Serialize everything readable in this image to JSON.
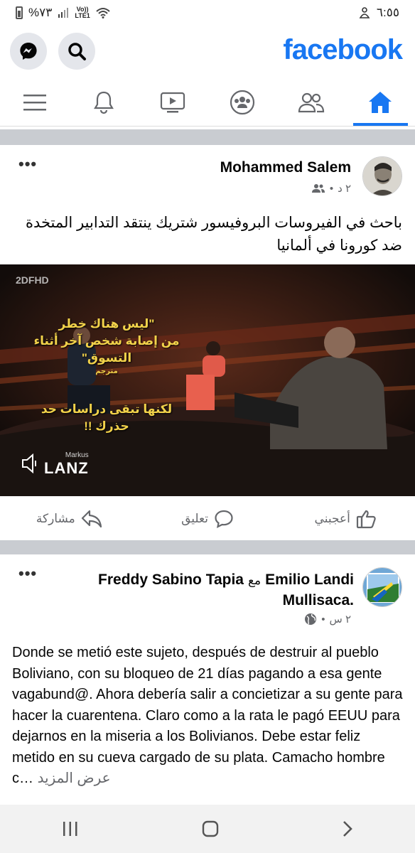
{
  "status_bar": {
    "battery": "%٧٣",
    "network": "Vo))",
    "network_sub": "LTE1",
    "time": "٦:٥٥"
  },
  "header": {
    "brand": "facebook"
  },
  "nav": {
    "items": [
      "menu-icon",
      "bell-icon",
      "video-icon",
      "groups-icon",
      "friends-icon",
      "home-icon"
    ],
    "active": "home-icon"
  },
  "post1": {
    "author": "Mohammed Salem",
    "time": "٢ د",
    "text": "باحث في الفيروسات البروفيسور شتريك ينتقد التدابير المتخدة ضد كورونا في ألمانيا",
    "video": {
      "channel": "2DFHD",
      "overlay_lines": [
        "\"ليس هناك خطر",
        "من إصابة شخص آخر أثناء التسوق\"",
        "مترجم",
        "لكنها تبقى دراسات حد حذرك !!"
      ],
      "show_top": "Markus",
      "show_bottom": "LANZ"
    },
    "actions": {
      "like": "أعجبني",
      "comment": "تعليق",
      "share": "مشاركة"
    }
  },
  "post2": {
    "author": "Emilio Landi",
    "with_word": "مع",
    "tagged": "Freddy Sabino Tapia",
    "tagged_line2": "Mullisaca",
    "time": "٢ س",
    "text": "Donde se metió este sujeto, después de destruir al pueblo Boliviano, con su bloqueo de 21 días pagando a esa gente vagabund@. Ahora debería salir a concietizar a su gente para hacer la cuarentena. Claro como a la rata le pagó EEUU para dejarnos en la miseria a los Bolivianos. Debe estar feliz metido en su cueva cargado de su plata. Camacho hombre c…",
    "see_more": "عرض المزيد"
  },
  "colors": {
    "brand": "#1877f2",
    "gray_text": "#65676b",
    "divider": "#c9ccd1"
  }
}
